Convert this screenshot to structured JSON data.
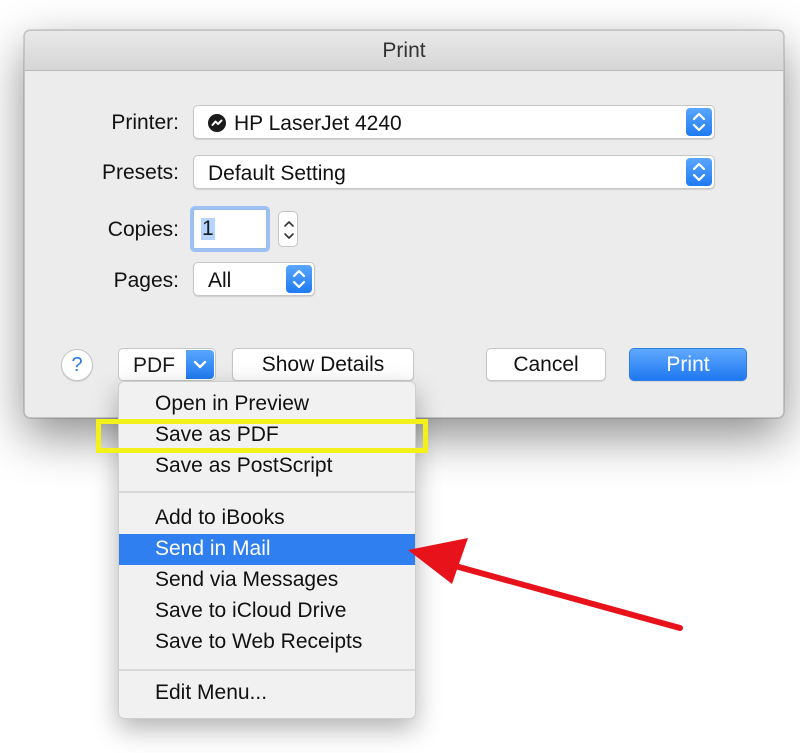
{
  "window": {
    "title": "Print"
  },
  "printer": {
    "label": "Printer:",
    "value": "HP LaserJet 4240"
  },
  "presets": {
    "label": "Presets:",
    "value": "Default Setting"
  },
  "copies": {
    "label": "Copies:",
    "value": "1"
  },
  "pages": {
    "label": "Pages:",
    "value": "All"
  },
  "footer": {
    "help": "?",
    "pdf": "PDF",
    "show_details": "Show Details",
    "cancel": "Cancel",
    "print": "Print"
  },
  "pdf_menu": {
    "groups": [
      [
        "Open in Preview",
        "Save as PDF",
        "Save as PostScript"
      ],
      [
        "Add to iBooks",
        "Send in Mail",
        "Send via Messages",
        "Save to iCloud Drive",
        "Save to Web Receipts"
      ],
      [
        "Edit Menu..."
      ]
    ],
    "selected": "Send in Mail"
  },
  "annotations": {
    "highlight_color": "#f2f21a",
    "arrow_color": "#e8121b"
  },
  "colors": {
    "accent": "#2f7ff1",
    "dialog_bg": "#ececec"
  }
}
